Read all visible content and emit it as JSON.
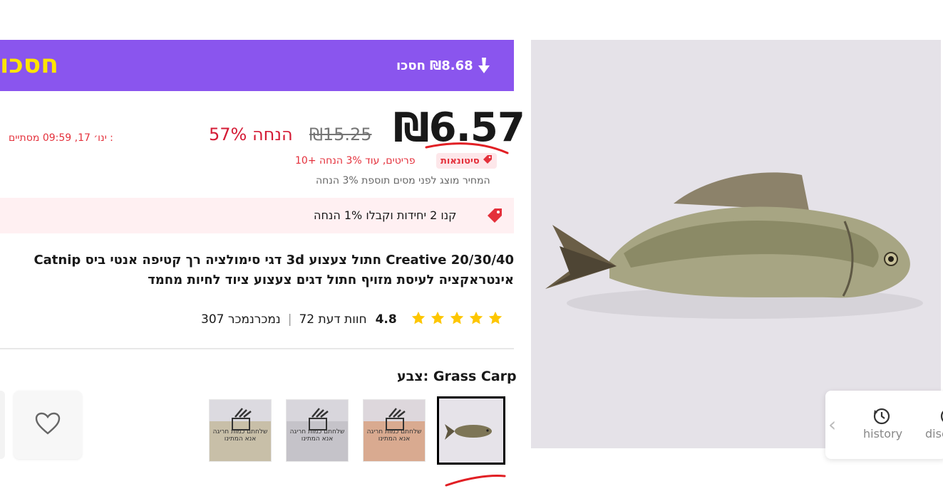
{
  "banner": {
    "left_text": "חסכו",
    "save_amount": "₪8.68",
    "save_label": "חסכו"
  },
  "price": {
    "current": "₪6.57",
    "original": "₪15.25",
    "discount": "57% הנחה",
    "timer_label": "מסתיים :",
    "timer_value": "ינו׳ 17, 09:59"
  },
  "wholesale": {
    "badge": "סיטונאות",
    "note": "10+ פריטים, עוד 3% הנחה"
  },
  "tax_note": "המחיר מוצג לפני מסים תוספת 3% הנחה",
  "promo": {
    "text": "קנו 2 יחידות וקבלו 1% הנחה"
  },
  "product": {
    "title": "20/30/40 Creative חתול צעצוע 3d דגי סימולציה רך קטיפה אנטי ביס Catnip אינטראקציה לעיסת מזויף חתול דגים צעצוע ציוד לחיות מחמד",
    "rating": "4.8",
    "reviews": "72 חוות דעת",
    "sold": "307 נמכרנמכר"
  },
  "variant": {
    "label": "צבע: Grass Carp",
    "thumb_overlay_text": "שלחתם כמות חריגה אנא המתינו"
  },
  "side_panel": {
    "history": "history",
    "discover": "disc"
  },
  "colors": {
    "brand_purple": "#8a55ee",
    "accent_yellow": "#ffe400",
    "price_red": "#d41b35",
    "star_yellow": "#fdc600"
  }
}
